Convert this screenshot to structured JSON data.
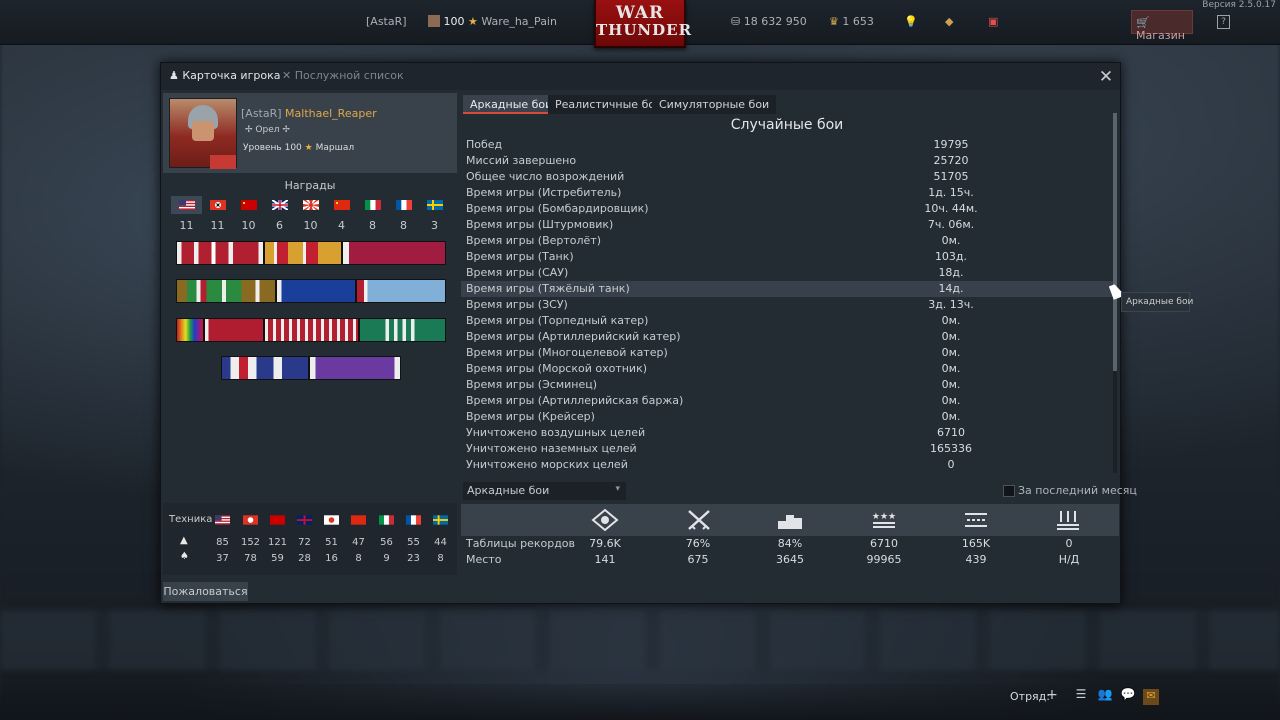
{
  "topbar": {
    "version": "Версия 2.5.0.17",
    "clan_tag": "[AstaR]",
    "level_value": "100",
    "player_name": "Ware_ha_Pain",
    "logo_line1": "WAR",
    "logo_line2": "THUNDER",
    "silver_lions": "18 632 950",
    "golden_eagles": "1 653",
    "shop_label": "Магазин",
    "help_label": "?"
  },
  "window": {
    "tab_player_card": "Карточка игрока",
    "tab_service_record": "Послужной список",
    "close_label": "✕"
  },
  "profile": {
    "clan": "[AstaR]",
    "nickname": "Malthael_Reaper",
    "title": "✢ Орел ✢",
    "level_text": "Уровень 100",
    "rank_text": "Маршал"
  },
  "awards": {
    "title": "Награды",
    "nations": [
      "usa",
      "germany",
      "ussr",
      "britain",
      "japan",
      "china",
      "italy",
      "france",
      "sweden"
    ],
    "counts": [
      "11",
      "11",
      "10",
      "6",
      "10",
      "4",
      "8",
      "8",
      "3"
    ]
  },
  "vehicles": {
    "label": "Техника",
    "researched": [
      "85",
      "152",
      "121",
      "72",
      "51",
      "47",
      "56",
      "55",
      "44"
    ],
    "elite": [
      "37",
      "78",
      "59",
      "28",
      "16",
      "8",
      "9",
      "23",
      "8"
    ]
  },
  "complain_button": "Пожаловаться",
  "mode_tabs": [
    "Аркадные бои",
    "Реалистичные бои",
    "Симуляторные бои"
  ],
  "section_title": "Случайные бои",
  "stats": [
    {
      "label": "Побед",
      "value": "19795"
    },
    {
      "label": "Миссий завершено",
      "value": "25720"
    },
    {
      "label": "Общее число возрождений",
      "value": "51705"
    },
    {
      "label": "Время игры (Истребитель)",
      "value": "1д. 15ч."
    },
    {
      "label": "Время игры (Бомбардировщик)",
      "value": "10ч. 44м."
    },
    {
      "label": "Время игры (Штурмовик)",
      "value": "7ч. 06м."
    },
    {
      "label": "Время игры (Вертолёт)",
      "value": "0м."
    },
    {
      "label": "Время игры (Танк)",
      "value": "103д."
    },
    {
      "label": "Время игры (САУ)",
      "value": "18д."
    },
    {
      "label": "Время игры (Тяжёлый танк)",
      "value": "14д."
    },
    {
      "label": "Время игры (ЗСУ)",
      "value": "3д. 13ч."
    },
    {
      "label": "Время игры (Торпедный катер)",
      "value": "0м."
    },
    {
      "label": "Время игры (Артиллерийский катер)",
      "value": "0м."
    },
    {
      "label": "Время игры (Многоцелевой катер)",
      "value": "0м."
    },
    {
      "label": "Время игры (Морской охотник)",
      "value": "0м."
    },
    {
      "label": "Время игры (Эсминец)",
      "value": "0м."
    },
    {
      "label": "Время игры (Артиллерийская баржа)",
      "value": "0м."
    },
    {
      "label": "Время игры (Крейсер)",
      "value": "0м."
    },
    {
      "label": "Уничтожено воздушных целей",
      "value": "6710"
    },
    {
      "label": "Уничтожено наземных целей",
      "value": "165336"
    },
    {
      "label": "Уничтожено морских целей",
      "value": "0"
    }
  ],
  "mode_select": {
    "value": "Аркадные бои"
  },
  "last_month_label": "За последний месяц",
  "records": {
    "row1_label": "Таблицы рекордов",
    "row1_values": [
      "79.6K",
      "76%",
      "84%",
      "6710",
      "165K",
      "0"
    ],
    "row2_label": "Место",
    "row2_values": [
      "141",
      "675",
      "3645",
      "99965",
      "439",
      "Н/Д"
    ]
  },
  "tooltip": "Аркадные бои",
  "bottombar": {
    "squad_label": "Отряд:"
  },
  "colors": {
    "accent_red": "#d84a3a",
    "nickname_gold": "#e0a84a",
    "panel": "#232b33"
  }
}
